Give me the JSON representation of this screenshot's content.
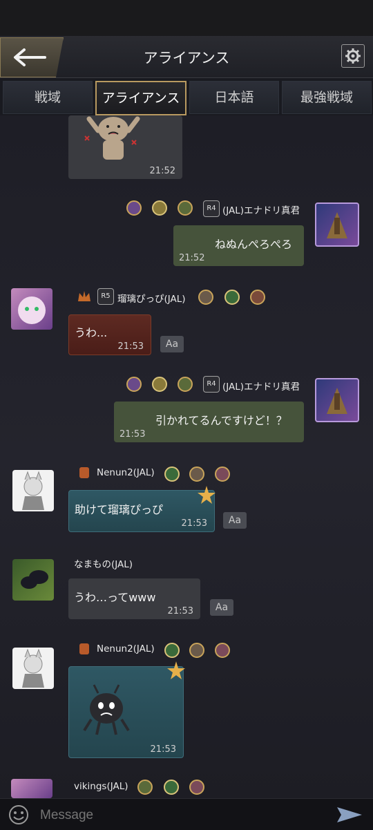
{
  "header": {
    "title": "アライアンス"
  },
  "tabs": [
    "戦域",
    "アライアンス",
    "日本語",
    "最強戦域"
  ],
  "active_tab": "アライアンス",
  "messages": [
    {
      "time": "21:52"
    },
    {
      "name": "(JAL)エナドリ真君",
      "rank": "R4",
      "text": "ねぬんぺろぺろ",
      "time": "21:52"
    },
    {
      "name": "瑠璃ぴっぴ(JAL)",
      "rank": "R5",
      "text": "うわ...",
      "time": "21:53"
    },
    {
      "name": "(JAL)エナドリ真君",
      "rank": "R4",
      "text": "引かれてるんですけど！？",
      "time": "21:53"
    },
    {
      "name": "Nenun2(JAL)",
      "text": "助けて瑠璃ぴっぴ",
      "time": "21:53"
    },
    {
      "name": "なまもの(JAL)",
      "text": "うわ…ってwww",
      "time": "21:53"
    },
    {
      "name": "Nenun2(JAL)",
      "time": "21:53"
    },
    {
      "name": "vikings(JAL)"
    }
  ],
  "translate_label": "Aa",
  "input": {
    "placeholder": "Message"
  },
  "colors": {
    "accent_gold": "#b99a60",
    "my_bubble": "#46533b",
    "teal_bubble": "#2f5864"
  }
}
